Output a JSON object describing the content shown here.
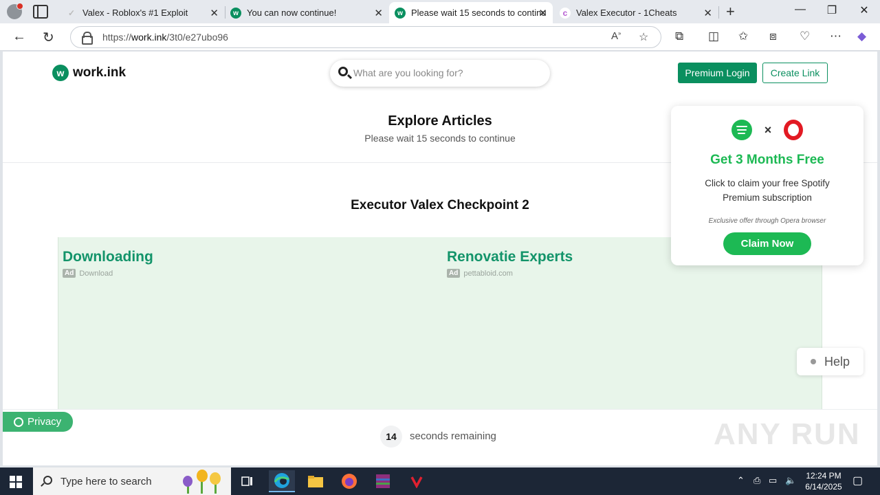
{
  "browser": {
    "tabs": [
      {
        "title": "Valex - Roblox's #1 Exploit",
        "favicon": "valex-icon"
      },
      {
        "title": "You can now continue!",
        "favicon": "workink-icon"
      },
      {
        "title": "Please wait 15 seconds to continu",
        "favicon": "workink-icon",
        "active": true
      },
      {
        "title": "Valex Executor - 1Cheats",
        "favicon": "1cheats-icon"
      }
    ],
    "url_prefix": "https://",
    "url_host": "work.ink",
    "url_path": "/3t0/e27ubo96"
  },
  "page": {
    "logo_text": "work.ink",
    "search_placeholder": "What are you looking for?",
    "premium_login": "Premium Login",
    "create_link": "Create Link",
    "explore_title": "Explore Articles",
    "explore_sub": "Please wait 15 seconds to continue",
    "checkpoint_title": "Executor Valex Checkpoint 2",
    "ads": [
      {
        "title": "Downloading",
        "badge": "Ad",
        "source": "Download"
      },
      {
        "title": "Renovatie Experts",
        "badge": "Ad",
        "source": "pettabloid.com"
      }
    ],
    "popup": {
      "title": "Get 3 Months Free",
      "text": "Click to claim your free Spotify Premium subscription",
      "note": "Exclusive offer through Opera browser",
      "button": "Claim Now"
    },
    "help": "Help",
    "privacy": "Privacy",
    "countdown": "14",
    "countdown_text": "seconds remaining",
    "watermark": "ANY RUN"
  },
  "taskbar": {
    "search_placeholder": "Type here to search",
    "time": "12:24 PM",
    "date": "6/14/2025"
  },
  "colors": {
    "brand_green": "#0a8f5f",
    "spotify_green": "#1db954",
    "opera_red": "#e21a23",
    "ad_bg": "#e8f5ea"
  }
}
